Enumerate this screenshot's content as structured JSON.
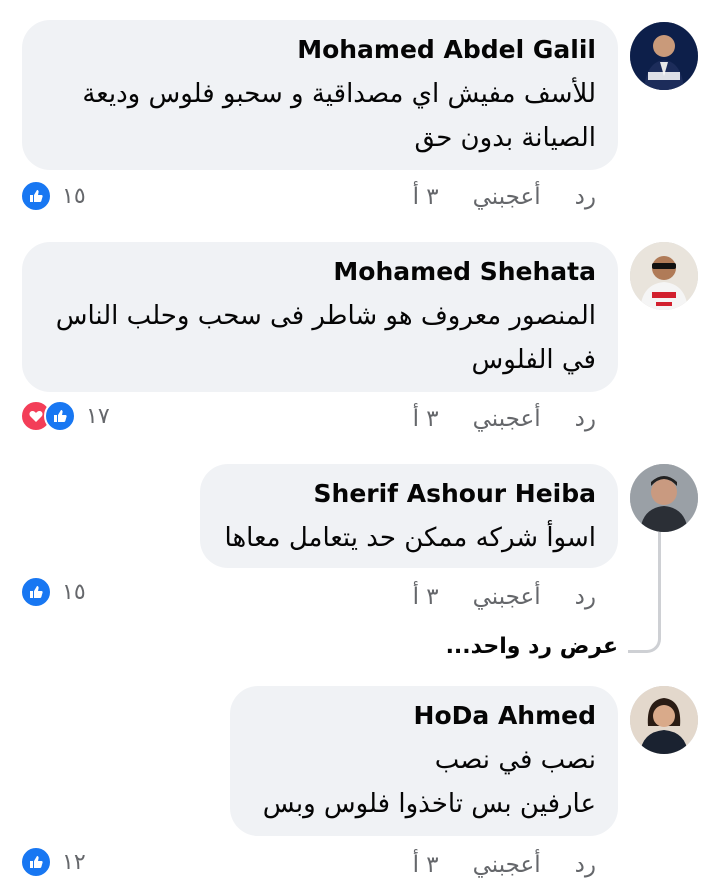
{
  "comments": [
    {
      "author": "Mohamed Abdel Galil",
      "lines": [
        "للأسف مفيش اي مصداقية و سحبو فلوس وديعة",
        "الصيانة بدون حق"
      ],
      "time": "٣ أ",
      "like_label": "أعجبني",
      "reply_label": "رد",
      "reaction_count": "١٥",
      "reactions": [
        "like-icon"
      ]
    },
    {
      "author": "Mohamed Shehata",
      "lines": [
        "المنصور معروف هو شاطر فى سحب وحلب الناس",
        "في الفلوس"
      ],
      "time": "٣ أ",
      "like_label": "أعجبني",
      "reply_label": "رد",
      "reaction_count": "١٧",
      "reactions": [
        "like-icon",
        "love-icon"
      ]
    },
    {
      "author": "Sherif Ashour Heiba",
      "lines": [
        "اسوأ شركه ممكن حد يتعامل معاها"
      ],
      "time": "٣ أ",
      "like_label": "أعجبني",
      "reply_label": "رد",
      "reaction_count": "١٥",
      "reactions": [
        "like-icon"
      ],
      "view_replies": "عرض رد واحد..."
    },
    {
      "author": "HoDa Ahmed",
      "lines": [
        "نصب في نصب",
        "عارفين بس تاخذوا فلوس وبس"
      ],
      "time": "٣ أ",
      "like_label": "أعجبني",
      "reply_label": "رد",
      "reaction_count": "١٢",
      "reactions": [
        "like-icon"
      ]
    }
  ],
  "colors": {
    "bubble": "#f0f2f5",
    "like_blue": "#1877f2",
    "love_red": "#f33e58",
    "meta_gray": "#65676b"
  }
}
